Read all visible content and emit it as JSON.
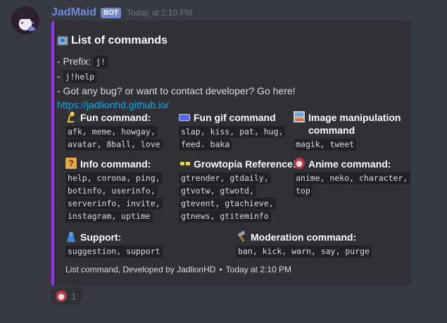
{
  "message": {
    "username": "JadMaid",
    "bot_tag": "BOT",
    "timestamp": "Today at 2:10 PM"
  },
  "embed": {
    "accent_color": "#9b30ff",
    "title": "List of commands",
    "title_icon": "desktop-computer-icon",
    "description": {
      "prefix_label": "- Prefix: ",
      "prefix_value": "j!",
      "help_prefix": "- ",
      "help_value": "j!help",
      "contact_line": "- Got any bug? or want to contact developer? Go here!",
      "link": "https://jadlionhd.github.io/"
    },
    "fields": [
      {
        "icon": "running-person-icon",
        "name": "Fun command:",
        "lines": [
          "afk, meme, howgay,",
          "avatar, 8ball, love"
        ]
      },
      {
        "icon": "gif-icon",
        "name": "Fun gif command",
        "lines": [
          "slap, kiss, pat, hug,",
          "feed. baka"
        ]
      },
      {
        "icon": "framed-picture-icon",
        "name": "Image manipulation command",
        "lines": [
          "magik, tweet"
        ]
      },
      {
        "icon": "question-block-icon",
        "name": "Info command:",
        "lines": [
          "help, corona, ping,",
          "botinfo, userinfo,",
          "serverinfo, invite,",
          "instagram, uptime"
        ]
      },
      {
        "icon": "sunglasses-icon",
        "name": "Growtopia Reference:",
        "lines": [
          "gtrender, gtdaily,",
          "gtvotw, gtwotd,",
          "gtevent, gtachieve,",
          "gtnews, gtiteminfo"
        ]
      },
      {
        "icon": "anime-girl-icon",
        "name": "Anime command:",
        "lines": [
          "anime, neko, character,",
          "top"
        ]
      },
      {
        "icon": "user-icon",
        "name": "Support:",
        "lines": [
          "suggestion, support"
        ]
      },
      {
        "icon": "hammer-icon",
        "name": "Moderation command:",
        "lines": [
          "ban, kick, warn, say, purge"
        ]
      }
    ],
    "footer": {
      "text": "List command, Developed by JadlionHD",
      "separator": "•",
      "timestamp": "Today at 2:10 PM"
    }
  },
  "reaction": {
    "emoji": "anime-girl-icon",
    "count": "1"
  }
}
